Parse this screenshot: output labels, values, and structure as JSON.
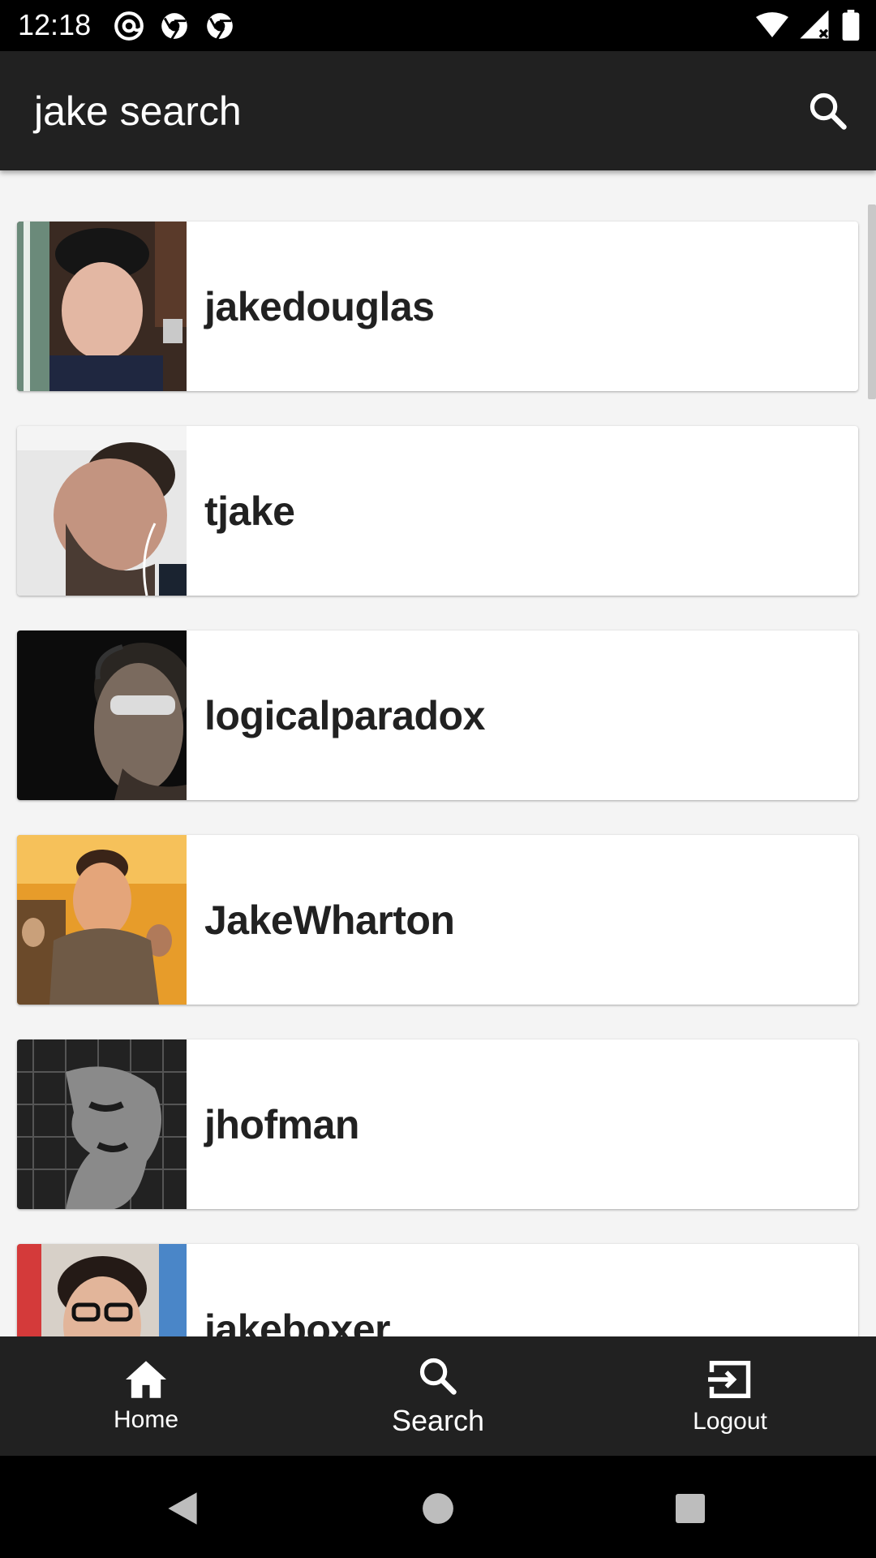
{
  "status_bar": {
    "time": "12:18",
    "left_icons": [
      "at-sign-icon",
      "chrome-icon",
      "chrome-icon"
    ],
    "right_icons": [
      "wifi-icon",
      "cell-signal-icon",
      "battery-icon"
    ]
  },
  "app_bar": {
    "title": "jake search",
    "search_icon": "search-icon"
  },
  "results": [
    {
      "username": "jakedouglas"
    },
    {
      "username": "tjake"
    },
    {
      "username": "logicalparadox"
    },
    {
      "username": "JakeWharton"
    },
    {
      "username": "jhofman"
    },
    {
      "username": "jakeboxer"
    }
  ],
  "bottom_nav": {
    "items": [
      {
        "label": "Home",
        "icon": "home-icon"
      },
      {
        "label": "Search",
        "icon": "search-icon",
        "active": true
      },
      {
        "label": "Logout",
        "icon": "logout-icon"
      }
    ]
  },
  "colors": {
    "app_bar": "#212121",
    "background": "#f4f4f4",
    "text_primary": "#212121"
  }
}
